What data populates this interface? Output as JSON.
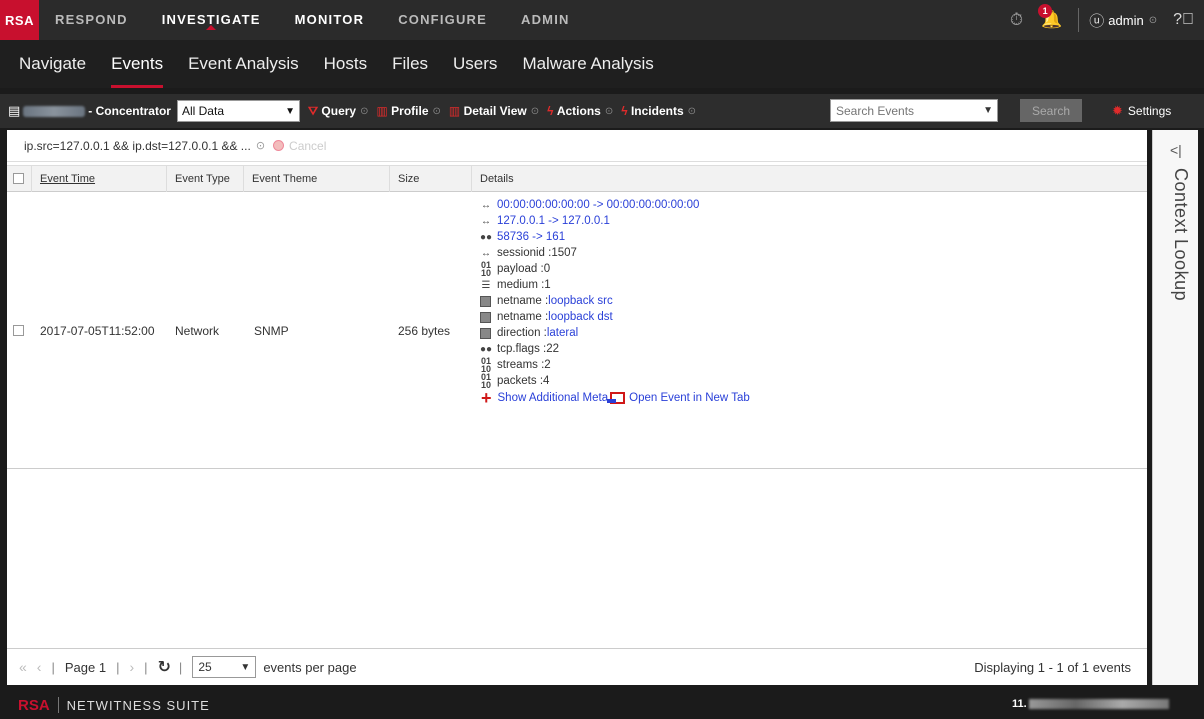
{
  "app": {
    "logo": "RSA",
    "top_nav": [
      "RESPOND",
      "INVESTIGATE",
      "MONITOR",
      "CONFIGURE",
      "ADMIN"
    ],
    "notification_count": "1",
    "user": "admin"
  },
  "sub_nav": [
    "Navigate",
    "Events",
    "Event Analysis",
    "Hosts",
    "Files",
    "Users",
    "Malware Analysis"
  ],
  "toolbar": {
    "service_suffix": "- Concentrator",
    "data_select": "All Data",
    "query": "Query",
    "profile": "Profile",
    "detail_view": "Detail View",
    "actions": "Actions",
    "incidents": "Incidents",
    "search_placeholder": "Search Events",
    "search_button": "Search",
    "settings": "Settings"
  },
  "query_bar": {
    "text": "ip.src=127.0.0.1 && ip.dst=127.0.0.1 && ...",
    "cancel": "Cancel"
  },
  "table": {
    "headers": [
      "Event Time",
      "Event Type",
      "Event Theme",
      "Size",
      "Details"
    ],
    "row": {
      "event_time": "2017-07-05T11:52:00",
      "event_type": "Network",
      "event_theme": "SNMP",
      "size": "256 bytes",
      "details": {
        "eth": "00:00:00:00:00:00  ->  00:00:00:00:00:00",
        "ip": "127.0.0.1  ->  127.0.0.1",
        "port": "58736  ->  161",
        "sessionid_label": "sessionid : ",
        "sessionid": "1507",
        "payload_label": "payload : ",
        "payload": "0",
        "medium_label": "medium : ",
        "medium": "1",
        "netname_label": "netname : ",
        "netname_src": "loopback src",
        "netname_dst": "loopback dst",
        "direction_label": "direction : ",
        "direction": "lateral",
        "tcpflags_label": "tcp.flags : ",
        "tcpflags": "22",
        "streams_label": "streams : ",
        "streams": "2",
        "packets_label": "packets : ",
        "packets": "4",
        "show_more": "Show Additional Meta",
        "open_new_tab": "Open Event in New Tab"
      }
    }
  },
  "pager": {
    "page_label": "Page 1",
    "per_page": "25",
    "per_page_label": "events per page",
    "displaying": "Displaying 1 - 1 of 1 events"
  },
  "context_lookup": "Context Lookup",
  "footer": {
    "brand": "RSA",
    "suite": "NETWITNESS SUITE",
    "version_prefix": "11."
  }
}
